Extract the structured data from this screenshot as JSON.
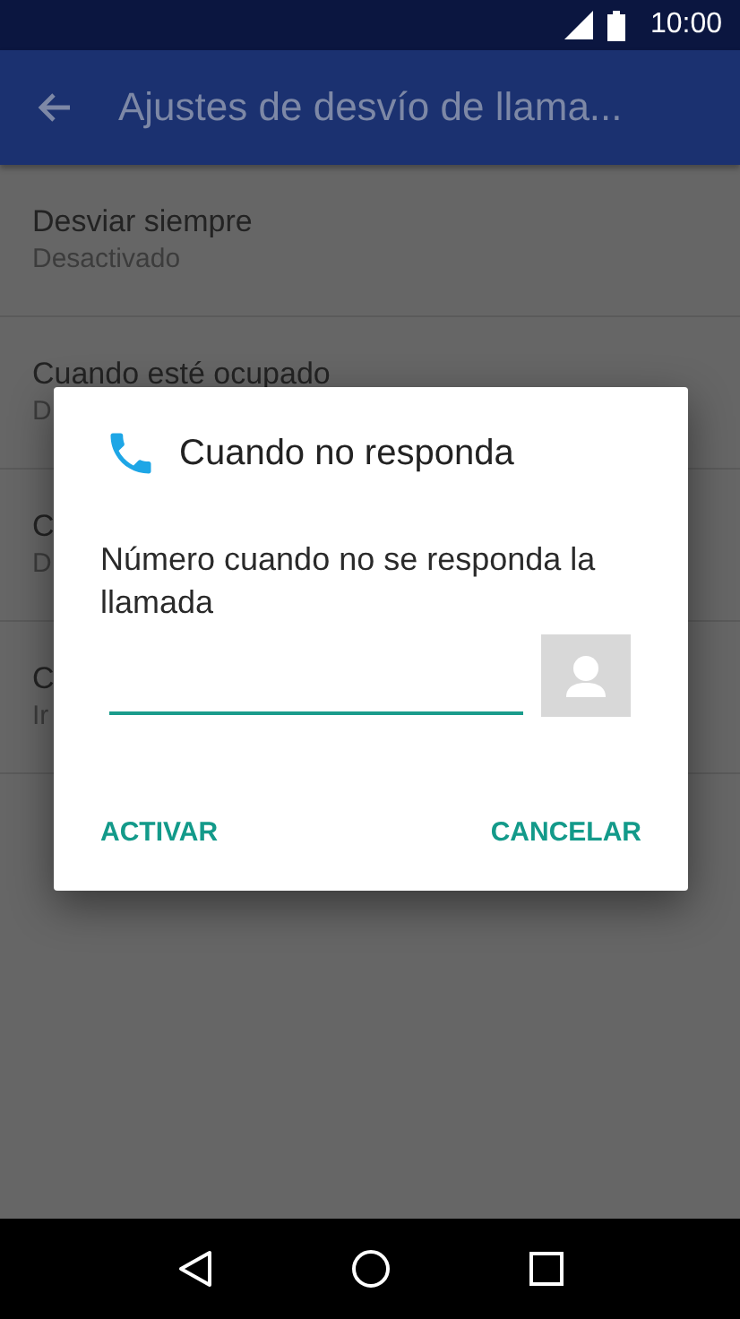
{
  "status_bar": {
    "time": "10:00"
  },
  "app_bar": {
    "title": "Ajustes de desvío de llama..."
  },
  "settings": [
    {
      "title": "Desviar siempre",
      "subtitle": "Desactivado"
    },
    {
      "title": "Cuando esté ocupado",
      "subtitle": "D"
    },
    {
      "title": "C",
      "subtitle": "D"
    },
    {
      "title": "C",
      "subtitle": "Ir"
    }
  ],
  "dialog": {
    "title": "Cuando no responda",
    "message": "Número cuando no se responda la llamada",
    "buttons": [
      "ACTIVAR",
      "CANCELAR"
    ]
  }
}
